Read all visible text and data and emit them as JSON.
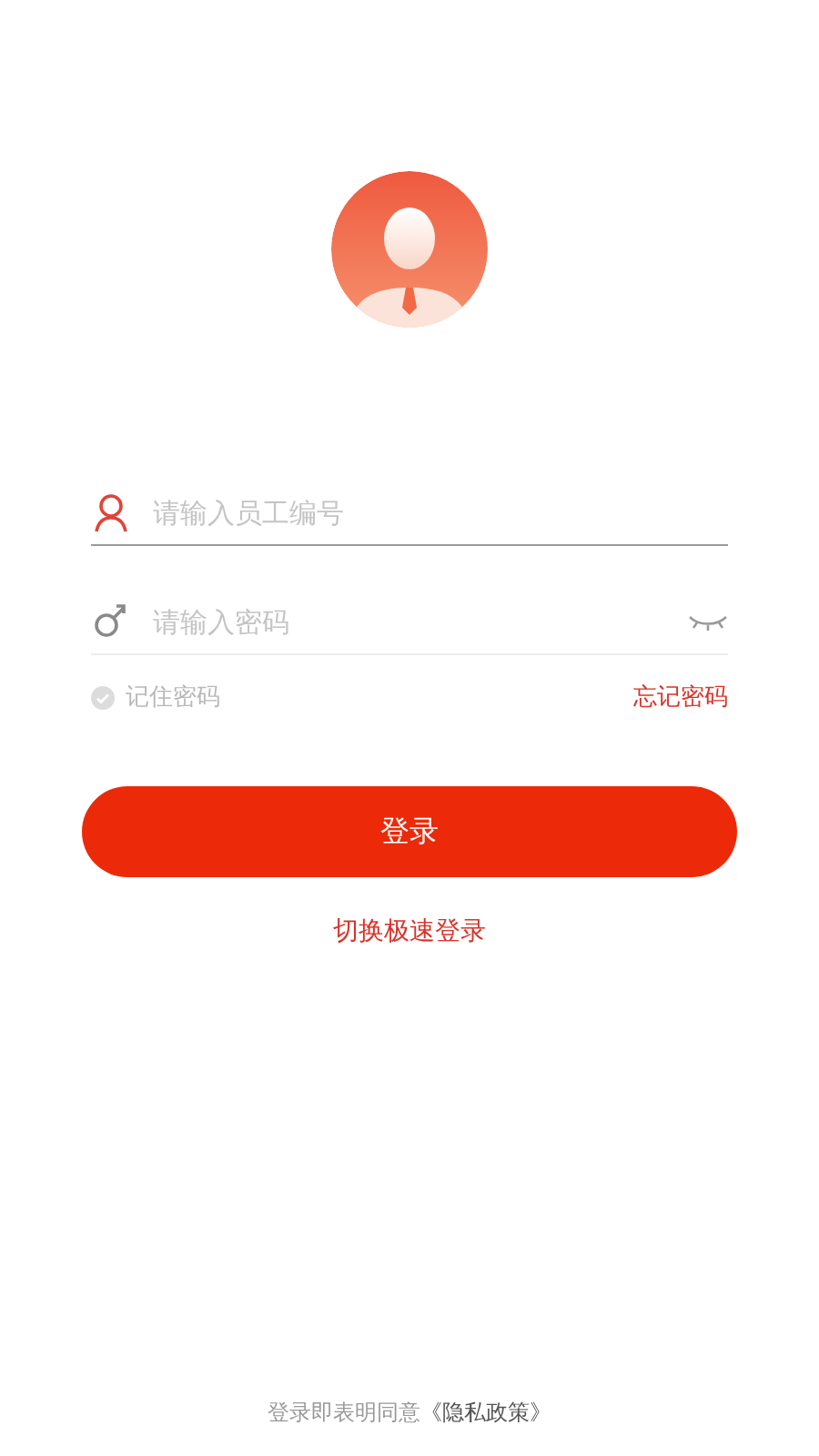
{
  "fields": [
    {
      "kind": "username",
      "placeholder": "请输入员工编号",
      "focused": true
    },
    {
      "kind": "password",
      "placeholder": "请输入密码",
      "focused": false
    }
  ],
  "remember": {
    "label": "记住密码",
    "checked": false
  },
  "forgot_link": "忘记密码",
  "login_button": "登录",
  "switch_link": "切换极速登录",
  "footer": {
    "text": "登录即表明同意",
    "link": "《隐私政策》"
  }
}
